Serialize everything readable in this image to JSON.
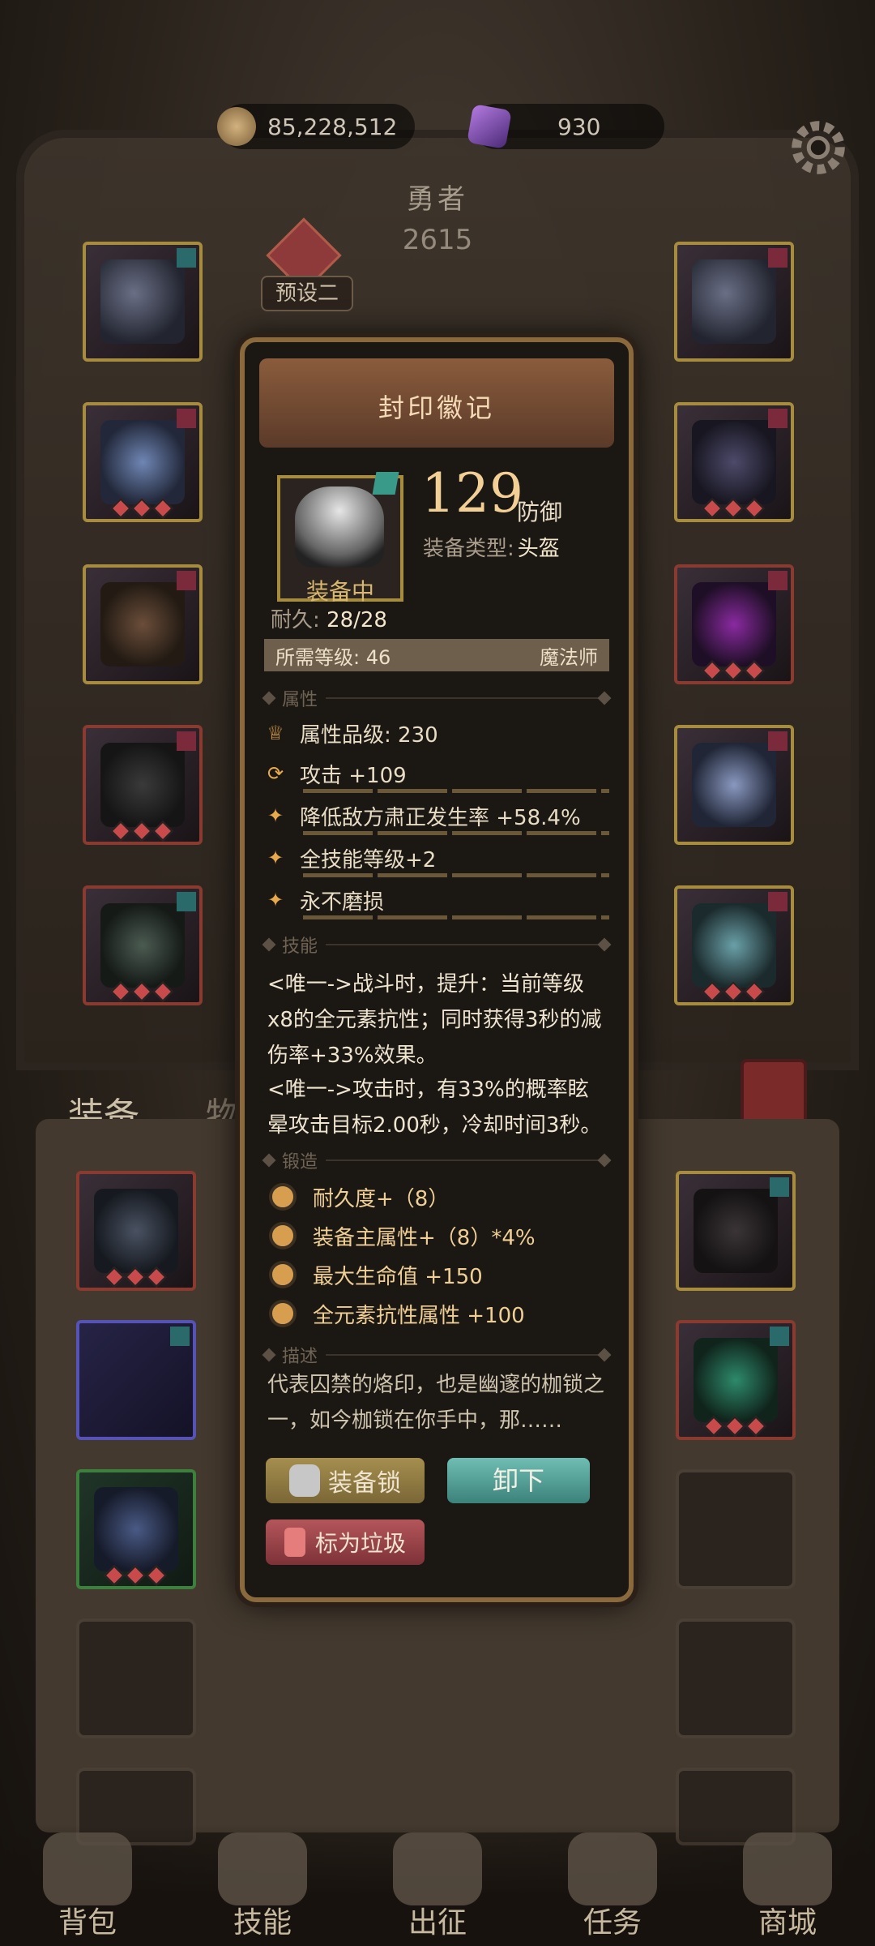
{
  "currency": {
    "gold": "85,228,512",
    "gems": "930"
  },
  "hero": {
    "name": "勇者",
    "power": "2615",
    "preset_label": "预设二"
  },
  "tabs": {
    "equipment": "装备",
    "items": "物品"
  },
  "popup": {
    "title": "封印徽记",
    "equipped_label": "装备中",
    "value": "129",
    "value_type": "防御",
    "equip_type_label": "装备类型:",
    "equip_type": "头盔",
    "durability_label": "耐久:",
    "durability": "28/28",
    "required_level_label": "所需等级: 46",
    "class": "魔法师",
    "sections": {
      "attributes": "属性",
      "skills": "技能",
      "forging": "锻造",
      "description": "描述"
    },
    "attributes": [
      {
        "icon": "crown-icon",
        "text": "属性品级: 230"
      },
      {
        "icon": "refresh-icon",
        "text": "攻击 +109"
      },
      {
        "icon": "star-icon",
        "text": "降低敌方肃正发生率 +58.4%"
      },
      {
        "icon": "star-icon",
        "text": "全技能等级+2"
      },
      {
        "icon": "star-icon",
        "text": "永不磨损"
      }
    ],
    "skills": [
      "<唯一->战斗时，提升：当前等级x8的全元素抗性；同时获得3秒的减伤率+33%效果。",
      "<唯一->攻击时，有33%的概率眩晕攻击目标2.00秒，冷却时间3秒。"
    ],
    "forging": [
      "耐久度+（8）",
      "装备主属性+（8）*4%",
      "最大生命值 +150",
      "全元素抗性属性 +100"
    ],
    "description": "代表囚禁的烙印，也是幽邃的枷锁之一，如今枷锁在你手中，那……",
    "buttons": {
      "lock": "装备锁",
      "unequip": "卸下",
      "junk": "标为垃圾"
    }
  },
  "nav": {
    "bag": "背包",
    "skills": "技能",
    "expedition": "出征",
    "quests": "任务",
    "shop": "商城"
  },
  "colors": {
    "accent_gold": "#f2cf95",
    "teal_button": "#4fa39a",
    "red_button": "#a24a4f",
    "rare_slot": "#a88c3e"
  }
}
